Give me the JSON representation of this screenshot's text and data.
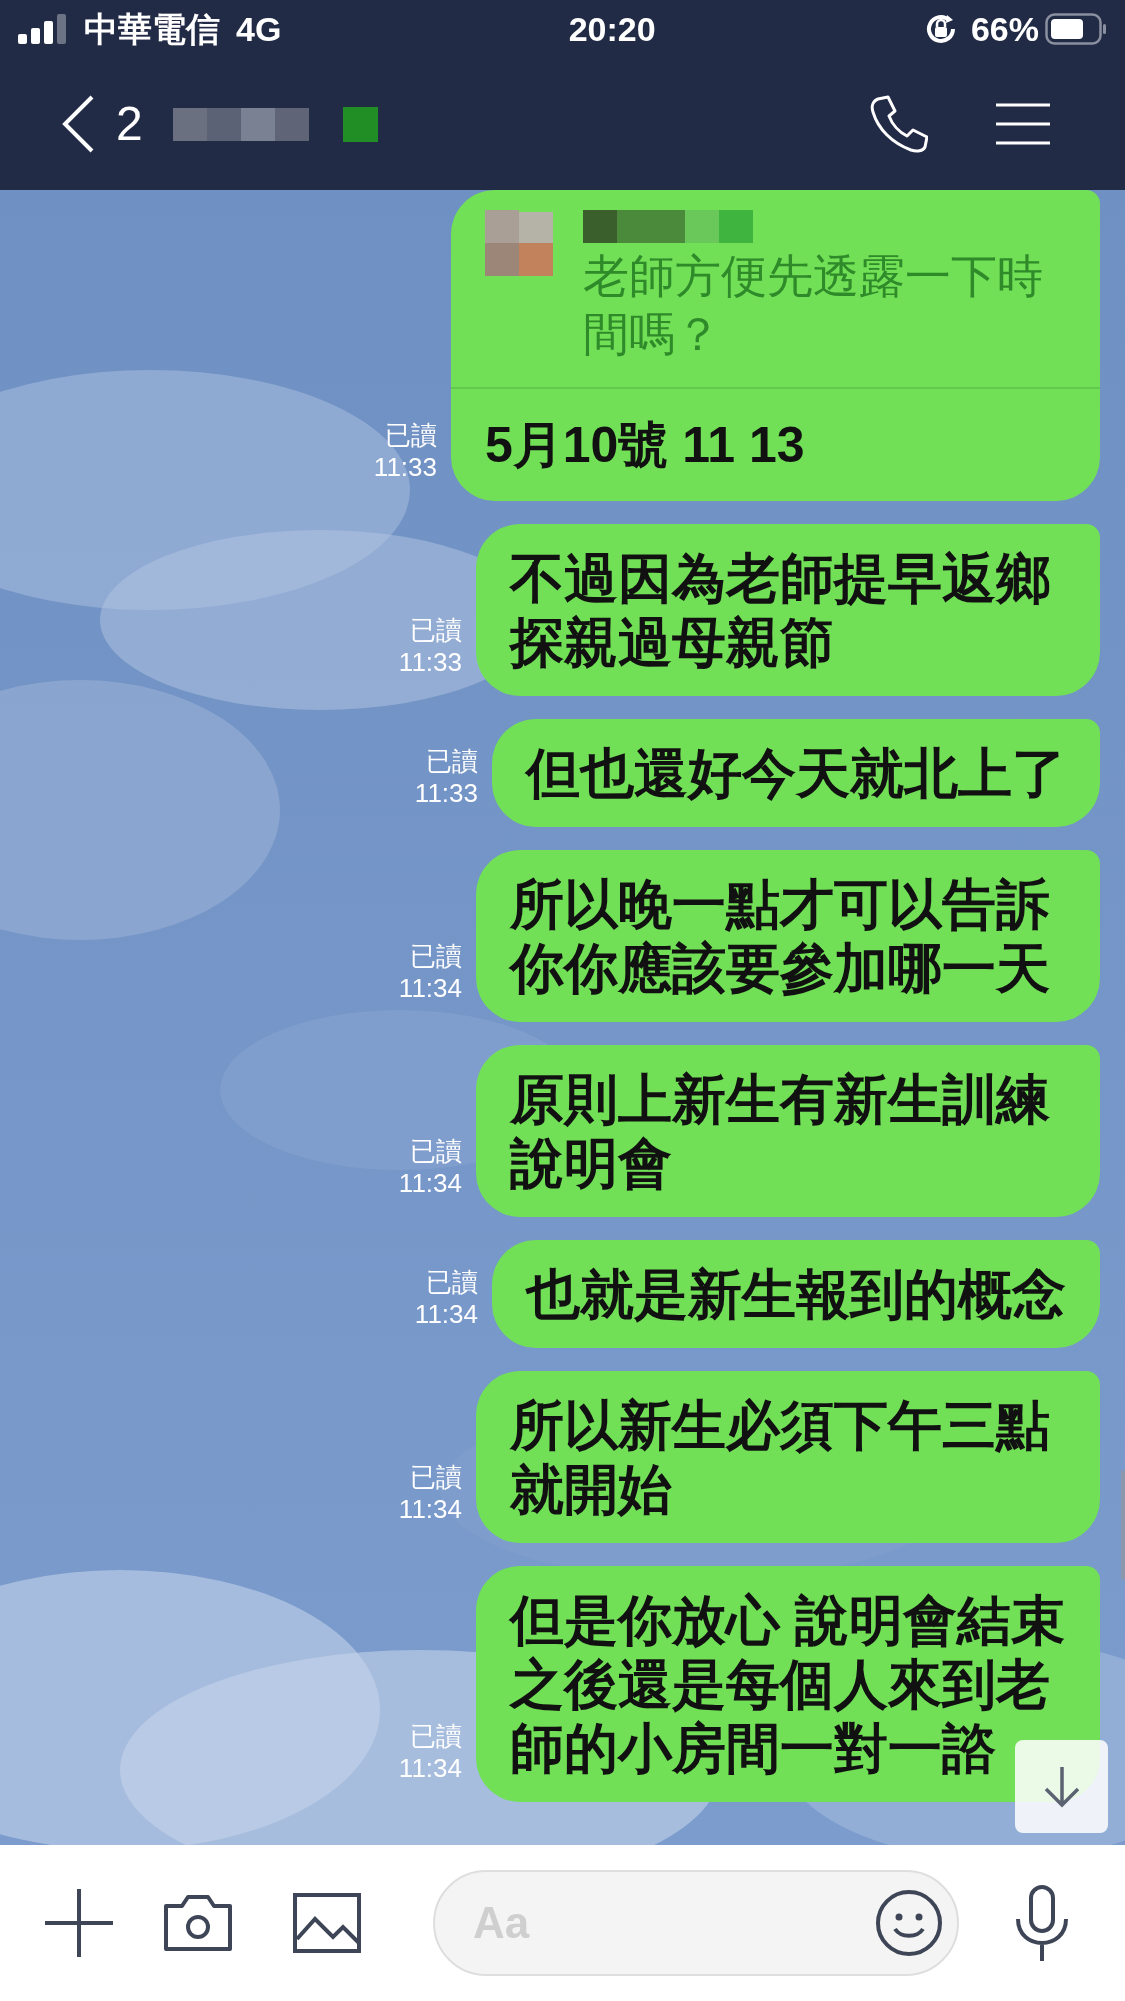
{
  "status_bar": {
    "carrier": "中華電信",
    "network": "4G",
    "time": "20:20",
    "battery": "66%"
  },
  "header": {
    "unread_count": "2"
  },
  "messages": [
    {
      "kind": "reply",
      "quoted_text": "老師方便先透露一下時間嗎？",
      "text": "5月10號 11 13",
      "read": "已讀",
      "time": "11:33"
    },
    {
      "kind": "text",
      "text": "不過因為老師提早返鄉探親過母親節",
      "read": "已讀",
      "time": "11:33"
    },
    {
      "kind": "text",
      "text": "但也還好今天就北上了",
      "read": "已讀",
      "time": "11:33"
    },
    {
      "kind": "text",
      "text": "所以晚一點才可以告訴你你應該要參加哪一天",
      "read": "已讀",
      "time": "11:34"
    },
    {
      "kind": "text",
      "text": "原則上新生有新生訓練說明會",
      "read": "已讀",
      "time": "11:34"
    },
    {
      "kind": "text",
      "text": "也就是新生報到的概念",
      "read": "已讀",
      "time": "11:34"
    },
    {
      "kind": "text",
      "text": "所以新生必須下午三點就開始",
      "read": "已讀",
      "time": "11:34"
    },
    {
      "kind": "text",
      "text": "但是你放心 說明會結束之後還是每個人來到老師的小房間一對一諮",
      "read": "已讀",
      "time": "11:34"
    }
  ],
  "input": {
    "placeholder": "Aa"
  }
}
